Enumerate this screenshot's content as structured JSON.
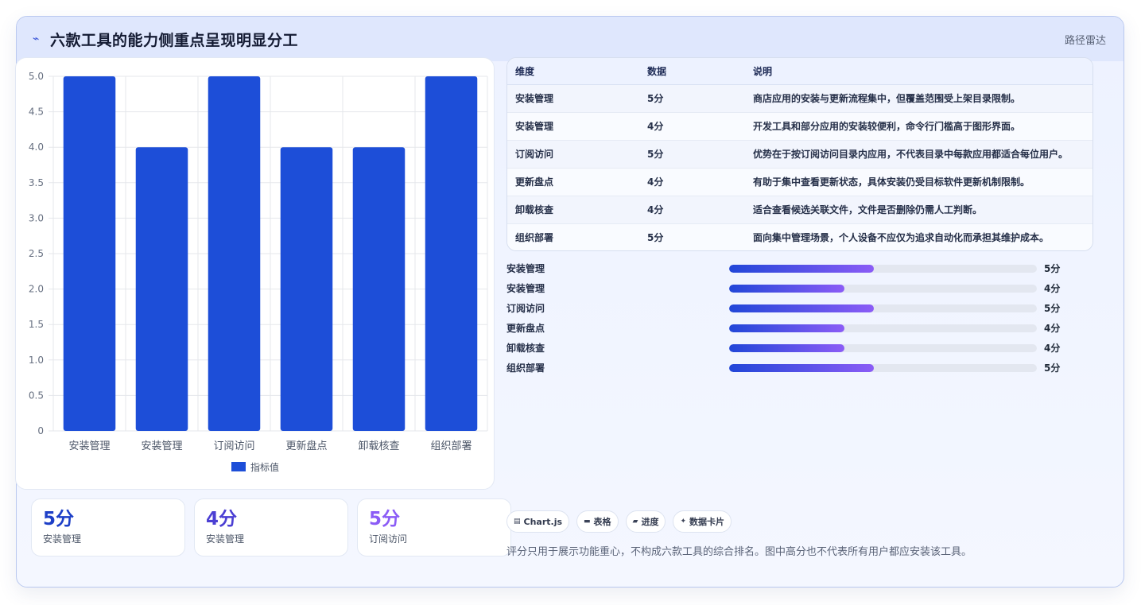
{
  "header": {
    "title": "六款工具的能力侧重点呈现明显分工",
    "tag": "路径雷达"
  },
  "chart_data": {
    "type": "bar",
    "categories": [
      "安装管理",
      "安装管理",
      "订阅访问",
      "更新盘点",
      "卸载核查",
      "组织部署"
    ],
    "series": [
      {
        "name": "指标值",
        "values": [
          5,
          4,
          5,
          4,
          4,
          5
        ]
      }
    ],
    "ylim": [
      0,
      5.0
    ],
    "yticks": [
      "0",
      "0.5",
      "1.0",
      "1.5",
      "2.0",
      "2.5",
      "3.0",
      "3.5",
      "4.0",
      "4.5",
      "5.0"
    ],
    "grid": true,
    "legend": "bottom",
    "bar_color": "#1d4ed8",
    "title": "",
    "xlabel": "",
    "ylabel": ""
  },
  "stats": [
    {
      "value": "5分",
      "label": "安装管理",
      "color": "#1d3fc7"
    },
    {
      "value": "4分",
      "label": "安装管理",
      "color": "#4b3fd3"
    },
    {
      "value": "5分",
      "label": "订阅访问",
      "color": "#8b5cf6"
    }
  ],
  "table": {
    "headers": [
      "维度",
      "数据",
      "说明"
    ],
    "rows": [
      {
        "dim": "安装管理",
        "val": "5分",
        "desc": "商店应用的安装与更新流程集中，但覆盖范围受上架目录限制。"
      },
      {
        "dim": "安装管理",
        "val": "4分",
        "desc": "开发工具和部分应用的安装较便利，命令行门槛高于图形界面。"
      },
      {
        "dim": "订阅访问",
        "val": "5分",
        "desc": "优势在于按订阅访问目录内应用，不代表目录中每款应用都适合每位用户。"
      },
      {
        "dim": "更新盘点",
        "val": "4分",
        "desc": "有助于集中查看更新状态，具体安装仍受目标软件更新机制限制。"
      },
      {
        "dim": "卸载核查",
        "val": "4分",
        "desc": "适合查看候选关联文件，文件是否删除仍需人工判断。"
      },
      {
        "dim": "组织部署",
        "val": "5分",
        "desc": "面向集中管理场景，个人设备不应仅为追求自动化而承担其维护成本。"
      }
    ]
  },
  "progress": [
    {
      "label": "安装管理",
      "value": "5分",
      "level": 0.47
    },
    {
      "label": "安装管理",
      "value": "4分",
      "level": 0.375
    },
    {
      "label": "订阅访问",
      "value": "5分",
      "level": 0.47
    },
    {
      "label": "更新盘点",
      "value": "4分",
      "level": 0.375
    },
    {
      "label": "卸载核查",
      "value": "4分",
      "level": 0.375
    },
    {
      "label": "组织部署",
      "value": "5分",
      "level": 0.47
    }
  ],
  "chips": [
    {
      "icon": "chart-icon",
      "glyph": "▤",
      "label": "Chart.js"
    },
    {
      "icon": "table-icon",
      "glyph": "▬",
      "label": "表格"
    },
    {
      "icon": "progress-icon",
      "glyph": "▰",
      "label": "进度"
    },
    {
      "icon": "sparkle-icon",
      "glyph": "✦",
      "label": "数据卡片"
    }
  ],
  "footnote": "评分只用于展示功能重心，不构成六款工具的综合排名。图中高分也不代表所有用户都应安装该工具。"
}
